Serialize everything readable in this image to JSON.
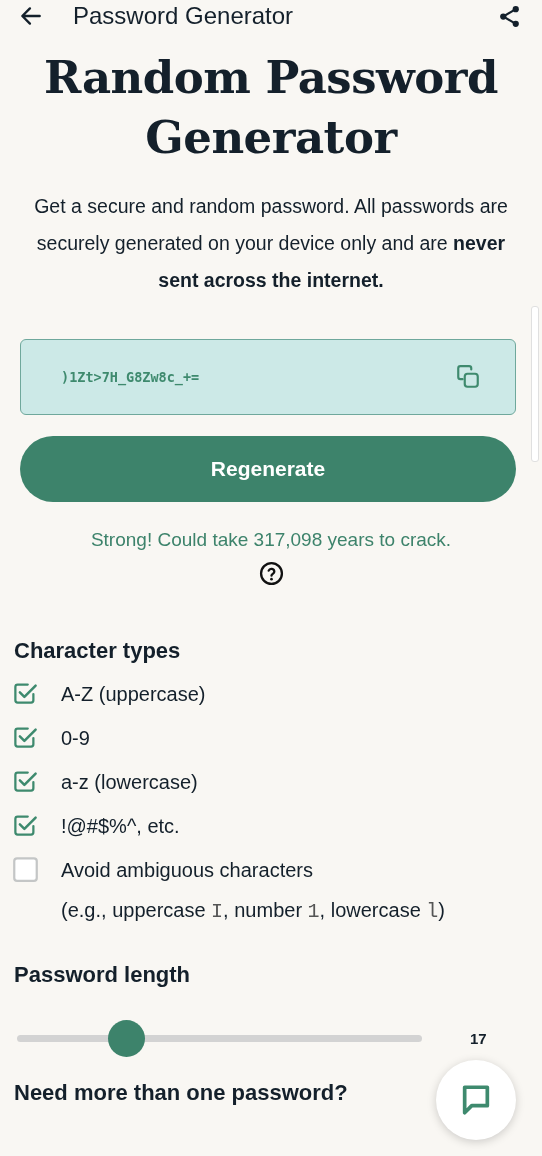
{
  "top_bar": {
    "title": "Password Generator"
  },
  "heading": "Random Password Generator",
  "intro": "Get a secure and random password. All passwords are securely generated on your device only and are **never sent across the internet.**",
  "password": {
    "value": ")1Zt>7H_G8Zw8c_+="
  },
  "regenerate_button": "Regenerate",
  "strength": "Strong! Could take 317,098 years to crack.",
  "character_types": {
    "title": "Character types",
    "options": [
      {
        "label": "A-Z (uppercase)",
        "checked": true
      },
      {
        "label": "0-9",
        "checked": true
      },
      {
        "label": "a-z (lowercase)",
        "checked": true
      },
      {
        "label": "!@#$%^, etc.",
        "checked": true
      },
      {
        "label": "Avoid ambiguous characters",
        "checked": false,
        "hint": [
          {
            "kind": "text",
            "text": "(e.g., uppercase "
          },
          {
            "kind": "code",
            "text": "I"
          },
          {
            "kind": "text",
            "text": ", number "
          },
          {
            "kind": "code",
            "text": "1"
          },
          {
            "kind": "text",
            "text": ", lowercase "
          },
          {
            "kind": "code",
            "text": "l"
          },
          {
            "kind": "text",
            "text": ")"
          }
        ]
      }
    ]
  },
  "password_length": {
    "title": "Password length",
    "level": 0.27,
    "reading": "17"
  },
  "more_passwords": {
    "title": "Need more than one password?"
  }
}
